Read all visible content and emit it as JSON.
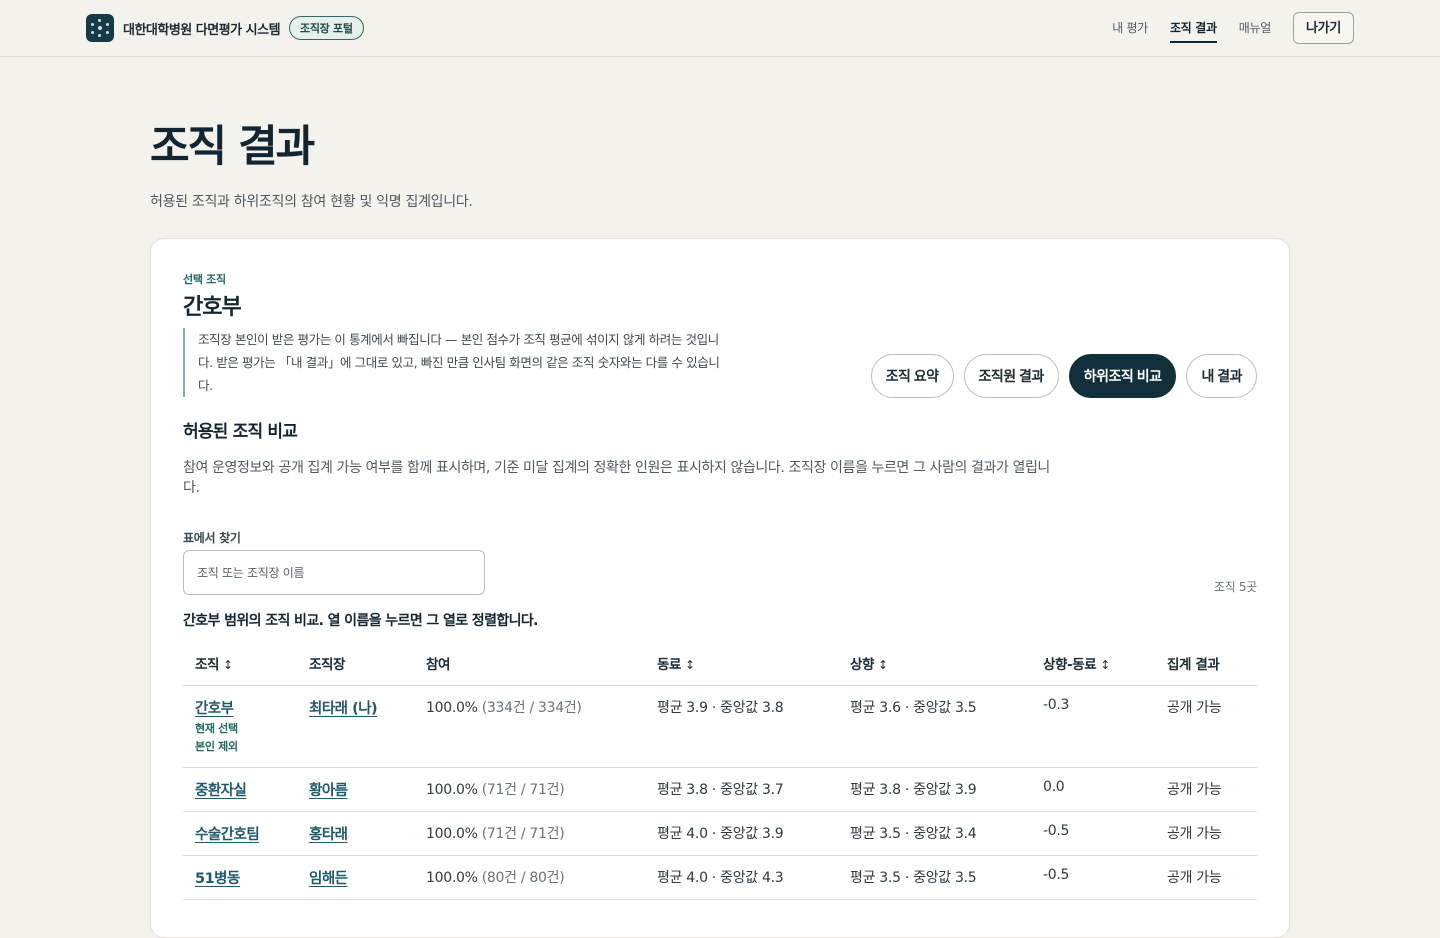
{
  "header": {
    "brand_name": "대한대학병원 다면평가 시스템",
    "portal_badge": "조직장 포털",
    "nav": [
      "내 평가",
      "조직 결과",
      "매뉴얼"
    ],
    "exit_label": "나가기"
  },
  "page": {
    "title": "조직 결과",
    "description": "허용된 조직과 하위조직의 참여 현황 및 익명 집계입니다."
  },
  "card": {
    "selected_label": "선택 조직",
    "selected_name": "간호부",
    "note": "조직장 본인이 받은 평가는 이 통계에서 빠집니다 — 본인 점수가 조직 평균에 섞이지 않게 하려는 것입니다. 받은 평가는 「내 결과」에 그대로 있고, 빠진 만큼 인사팀 화면의 같은 조직 숫자와는 다를 수 있습니다.",
    "tabs": [
      "조직 요약",
      "조직원 결과",
      "하위조직 비교",
      "내 결과"
    ],
    "active_tab": "하위조직 비교",
    "section_title": "허용된 조직 비교",
    "section_desc": "참여 운영정보와 공개 집계 가능 여부를 함께 표시하며, 기준 미달 집계의 정확한 인원은 표시하지 않습니다. 조직장 이름을 누르면 그 사람의 결과가 열립니다.",
    "search_label": "표에서 찾기",
    "search_placeholder": "조직 또는 조직장 이름",
    "count": "조직 5곳",
    "caption": "간호부 범위의 조직 비교. 열 이름을 누르면 그 열로 정렬합니다."
  },
  "table": {
    "columns": [
      "조직",
      "조직장",
      "참여",
      "동료",
      "상향",
      "상향-동료",
      "집계 결과"
    ],
    "sort_icon": "↕",
    "rows": [
      {
        "org": "간호부",
        "tags": [
          "현재 선택",
          "본인 제외"
        ],
        "leader": "최타래 (나)",
        "rate": "100.0%",
        "rate_detail": "(334건 / 334건)",
        "peer": "평균 3.9 · 중앙값 3.8",
        "upward": "평균 3.6 · 중앙값 3.5",
        "diff": "-0.3",
        "result": "공개 가능"
      },
      {
        "org": "중환자실",
        "tags": [],
        "leader": "황아름",
        "rate": "100.0%",
        "rate_detail": "(71건 / 71건)",
        "peer": "평균 3.8 · 중앙값 3.7",
        "upward": "평균 3.8 · 중앙값 3.9",
        "diff": "0.0",
        "result": "공개 가능"
      },
      {
        "org": "수술간호팀",
        "tags": [],
        "leader": "홍타래",
        "rate": "100.0%",
        "rate_detail": "(71건 / 71건)",
        "peer": "평균 4.0 · 중앙값 3.9",
        "upward": "평균 3.5 · 중앙값 3.4",
        "diff": "-0.5",
        "result": "공개 가능"
      },
      {
        "org": "51병동",
        "tags": [],
        "leader": "임해든",
        "rate": "100.0%",
        "rate_detail": "(80건 / 80건)",
        "peer": "평균 4.0 · 중앙값 4.3",
        "upward": "평균 3.5 · 중앙값 3.5",
        "diff": "-0.5",
        "result": "공개 가능"
      }
    ]
  }
}
